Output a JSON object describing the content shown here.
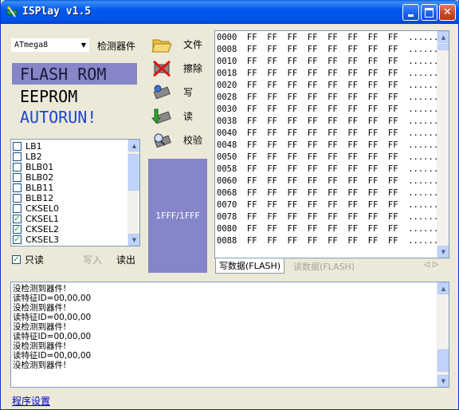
{
  "window": {
    "title": "ISPlay v1.5"
  },
  "chip": {
    "selected": "ATmega8",
    "detect_label": "检测器件"
  },
  "memory": {
    "flash": "FLASH ROM",
    "eeprom": "EEPROM",
    "autorun": "AUTORUN!"
  },
  "fuses": [
    {
      "label": "LB1",
      "checked": false
    },
    {
      "label": "LB2",
      "checked": false
    },
    {
      "label": "BLB01",
      "checked": false
    },
    {
      "label": "BLB02",
      "checked": false
    },
    {
      "label": "BLB11",
      "checked": false
    },
    {
      "label": "BLB12",
      "checked": false
    },
    {
      "label": "CKSEL0",
      "checked": false
    },
    {
      "label": "CKSEL1",
      "checked": true
    },
    {
      "label": "CKSEL2",
      "checked": true
    },
    {
      "label": "CKSEL3",
      "checked": true
    }
  ],
  "options": {
    "readonly_label": "只读",
    "readonly_checked": true,
    "write_label": "写入",
    "read_label": "读出"
  },
  "actions": {
    "file": "文件",
    "erase": "擦除",
    "write": "写",
    "read": "读",
    "verify": "校验"
  },
  "progress": {
    "text": "1FFF/1FFF"
  },
  "hex": [
    "0000  FF  FF  FF  FF  FF  FF  FF  FF  ........",
    "0008  FF  FF  FF  FF  FF  FF  FF  FF  ........",
    "0010  FF  FF  FF  FF  FF  FF  FF  FF  ........",
    "0018  FF  FF  FF  FF  FF  FF  FF  FF  ........",
    "0020  FF  FF  FF  FF  FF  FF  FF  FF  ........",
    "0028  FF  FF  FF  FF  FF  FF  FF  FF  ........",
    "0030  FF  FF  FF  FF  FF  FF  FF  FF  ........",
    "0038  FF  FF  FF  FF  FF  FF  FF  FF  ........",
    "0040  FF  FF  FF  FF  FF  FF  FF  FF  ........",
    "0048  FF  FF  FF  FF  FF  FF  FF  FF  ........",
    "0050  FF  FF  FF  FF  FF  FF  FF  FF  ........",
    "0058  FF  FF  FF  FF  FF  FF  FF  FF  ........",
    "0060  FF  FF  FF  FF  FF  FF  FF  FF  ........",
    "0068  FF  FF  FF  FF  FF  FF  FF  FF  ........",
    "0070  FF  FF  FF  FF  FF  FF  FF  FF  ........",
    "0078  FF  FF  FF  FF  FF  FF  FF  FF  ........",
    "0080  FF  FF  FF  FF  FF  FF  FF  FF  ........",
    "0088  FF  FF  FF  FF  FF  FF  FF  FF  ........"
  ],
  "tabs": {
    "write_data": "写数据(FLASH)",
    "read_data": "读数据(FLASH)"
  },
  "log": [
    "没检测到器件!",
    "读特征ID=00,00,00",
    "没检测到器件!",
    "读特征ID=00,00,00",
    "没检测到器件!",
    "读特征ID=00,00,00",
    "没检测到器件!",
    "读特征ID=00,00,00",
    "没检测到器件!"
  ],
  "footer": {
    "settings_link": "程序设置"
  }
}
